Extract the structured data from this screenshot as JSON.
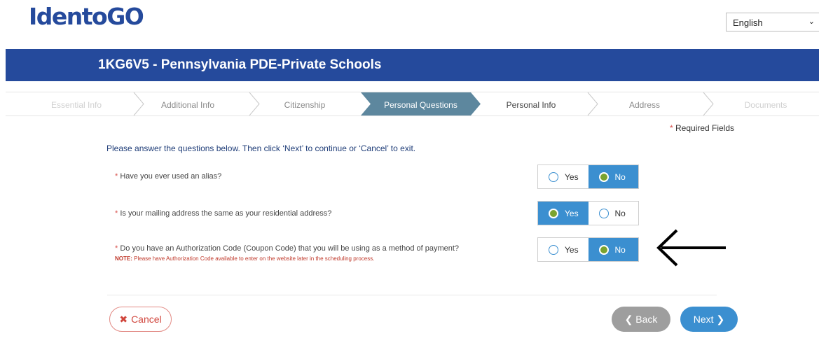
{
  "brand": {
    "logo": "IdentoGO"
  },
  "language": {
    "selected": "English"
  },
  "banner": {
    "title": "1KG6V5 - Pennsylvania PDE-Private Schools"
  },
  "steps": [
    {
      "label": "Essential Info",
      "state": "done"
    },
    {
      "label": "Additional Info",
      "state": "done"
    },
    {
      "label": "Citizenship",
      "state": "done"
    },
    {
      "label": "Personal Questions",
      "state": "active"
    },
    {
      "label": "Personal Info",
      "state": "next"
    },
    {
      "label": "Address",
      "state": "upcoming"
    },
    {
      "label": "Documents",
      "state": "upcoming"
    }
  ],
  "required_note": {
    "star": "*",
    "text": "Required Fields"
  },
  "intro": "Please answer the questions below. Then click ‘Next’ to continue or ‘Cancel’ to exit.",
  "questions": [
    {
      "star": "*",
      "text": "Have you ever used an alias?",
      "yes": "Yes",
      "no": "No",
      "selected": "No"
    },
    {
      "star": "*",
      "text": "Is your mailing address the same as your residential address?",
      "yes": "Yes",
      "no": "No",
      "selected": "Yes"
    },
    {
      "star": "*",
      "text": "Do you have an Authorization Code (Coupon Code) that you will be using as a method of payment?",
      "note_label": "NOTE:",
      "note": "Please have Authorization Code available to enter on the website later in the scheduling process.",
      "yes": "Yes",
      "no": "No",
      "selected": "No"
    }
  ],
  "buttons": {
    "cancel": "Cancel",
    "back": "Back",
    "next": "Next"
  },
  "icons": {
    "cancel": "times-icon",
    "back": "chevron-left-icon",
    "next": "chevron-right-icon",
    "annotation": "arrow-left-icon"
  },
  "colors": {
    "brand": "#254a9c",
    "active_step": "#5d879e",
    "primary": "#3b8fd0",
    "radio_selected": "#7aa32f",
    "danger": "#d0453c"
  }
}
